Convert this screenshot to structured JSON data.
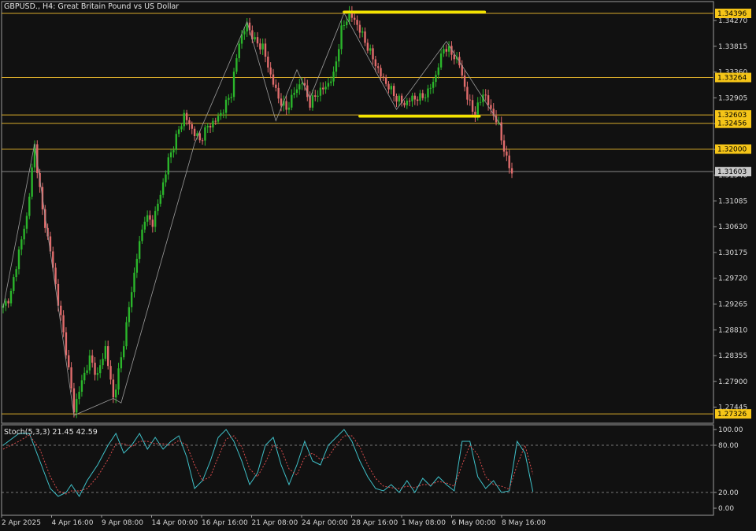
{
  "header": {
    "symbol": "GBPUSD.",
    "timeframe": "H4",
    "description": "Great Britain Pound vs US Dollar"
  },
  "colors": {
    "background": "#111111",
    "bull": "#2bb52b",
    "bear": "#e06c6c",
    "level_line": "#d6a92a",
    "price_line": "#8a8a8a",
    "highlight": "#f2e300",
    "stoch_main": "#3fc1c9",
    "stoch_signal": "#d94c4c"
  },
  "chart_data": [
    {
      "type": "candlestick",
      "title": "GBPUSD., H4:  Great Britain Pound vs US Dollar",
      "ylim": [
        1.27,
        1.346
      ],
      "y_ticks": [
        "1.34270",
        "1.33815",
        "1.33360",
        "1.32905",
        "1.32450",
        "1.31995",
        "1.31540",
        "1.31085",
        "1.30630",
        "1.30175",
        "1.29720",
        "1.29265",
        "1.28810",
        "1.28355",
        "1.27900",
        "1.27445"
      ],
      "x_labels": [
        "2 Apr 2025",
        "4 Apr 16:00",
        "9 Apr 08:00",
        "14 Apr 00:00",
        "16 Apr 16:00",
        "21 Apr 08:00",
        "24 Apr 00:00",
        "28 Apr 16:00",
        "1 May 08:00",
        "6 May 00:00",
        "8 May 16:00"
      ],
      "close_path": [
        [
          0,
          1.292
        ],
        [
          3,
          1.2945
        ],
        [
          6,
          1.302
        ],
        [
          9,
          1.308
        ],
        [
          12,
          1.3205
        ],
        [
          15,
          1.309
        ],
        [
          18,
          1.302
        ],
        [
          21,
          1.293
        ],
        [
          24,
          1.2845
        ],
        [
          27,
          1.274
        ],
        [
          30,
          1.279
        ],
        [
          33,
          1.283
        ],
        [
          36,
          1.28
        ],
        [
          39,
          1.285
        ],
        [
          42,
          1.276
        ],
        [
          45,
          1.283
        ],
        [
          48,
          1.292
        ],
        [
          51,
          1.301
        ],
        [
          54,
          1.308
        ],
        [
          57,
          1.307
        ],
        [
          60,
          1.312
        ],
        [
          63,
          1.318
        ],
        [
          66,
          1.322
        ],
        [
          69,
          1.326
        ],
        [
          72,
          1.3235
        ],
        [
          75,
          1.3215
        ],
        [
          78,
          1.324
        ],
        [
          81,
          1.325
        ],
        [
          84,
          1.327
        ],
        [
          87,
          1.33
        ],
        [
          90,
          1.339
        ],
        [
          93,
          1.342
        ],
        [
          96,
          1.339
        ],
        [
          99,
          1.338
        ],
        [
          102,
          1.333
        ],
        [
          105,
          1.329
        ],
        [
          108,
          1.327
        ],
        [
          111,
          1.33
        ],
        [
          114,
          1.332
        ],
        [
          117,
          1.328
        ],
        [
          120,
          1.33
        ],
        [
          123,
          1.331
        ],
        [
          126,
          1.333
        ],
        [
          129,
          1.341
        ],
        [
          132,
          1.344
        ],
        [
          135,
          1.342
        ],
        [
          138,
          1.339
        ],
        [
          141,
          1.336
        ],
        [
          144,
          1.333
        ],
        [
          147,
          1.331
        ],
        [
          150,
          1.329
        ],
        [
          153,
          1.328
        ],
        [
          156,
          1.329
        ],
        [
          159,
          1.329
        ],
        [
          162,
          1.33
        ],
        [
          165,
          1.333
        ],
        [
          168,
          1.338
        ],
        [
          171,
          1.337
        ],
        [
          174,
          1.335
        ],
        [
          177,
          1.329
        ],
        [
          180,
          1.326
        ],
        [
          183,
          1.33
        ],
        [
          186,
          1.327
        ],
        [
          189,
          1.324
        ],
        [
          192,
          1.318
        ],
        [
          194,
          1.316
        ]
      ],
      "swing_path": [
        [
          0,
          1.292
        ],
        [
          12,
          1.321
        ],
        [
          27,
          1.273
        ],
        [
          42,
          1.276
        ],
        [
          45,
          1.2752
        ],
        [
          73,
          1.321
        ],
        [
          93,
          1.3425
        ],
        [
          99,
          1.333
        ],
        [
          104,
          1.325
        ],
        [
          112,
          1.334
        ],
        [
          117,
          1.329
        ],
        [
          130,
          1.344
        ],
        [
          150,
          1.327
        ],
        [
          169,
          1.339
        ],
        [
          190,
          1.324
        ]
      ],
      "price_labels": [
        {
          "text": "1.34396",
          "value": 1.34396
        },
        {
          "text": "1.33264",
          "value": 1.33264
        },
        {
          "text": "1.32603",
          "value": 1.32603
        },
        {
          "text": "1.32456",
          "value": 1.32456
        },
        {
          "text": "1.32000",
          "value": 1.32
        },
        {
          "text": "1.31603",
          "value": 1.31603
        },
        {
          "text": "1.27326",
          "value": 1.27326
        }
      ],
      "current_price_label": "1.31603",
      "highlights": [
        {
          "from": 133,
          "to": 186,
          "value": 1.3442
        },
        {
          "from": 139,
          "to": 184,
          "value": 1.3258
        }
      ]
    },
    {
      "type": "line",
      "title": "Stoch(5,3,3) 21.45 42.59",
      "ylim": [
        0,
        100
      ],
      "y_ticks": [
        "100.00",
        "80.00",
        "20.00",
        "0.00"
      ],
      "levels": [
        80,
        20
      ],
      "series": [
        {
          "name": "main",
          "color": "#3fc1c9",
          "points": [
            [
              0,
              80
            ],
            [
              6,
              95
            ],
            [
              10,
              95
            ],
            [
              14,
              60
            ],
            [
              18,
              25
            ],
            [
              21,
              15
            ],
            [
              24,
              20
            ],
            [
              26,
              30
            ],
            [
              29,
              15
            ],
            [
              32,
              35
            ],
            [
              36,
              55
            ],
            [
              40,
              80
            ],
            [
              43,
              95
            ],
            [
              46,
              70
            ],
            [
              49,
              80
            ],
            [
              52,
              95
            ],
            [
              55,
              75
            ],
            [
              58,
              90
            ],
            [
              61,
              75
            ],
            [
              64,
              85
            ],
            [
              67,
              92
            ],
            [
              70,
              65
            ],
            [
              73,
              25
            ],
            [
              76,
              35
            ],
            [
              79,
              60
            ],
            [
              82,
              90
            ],
            [
              85,
              100
            ],
            [
              88,
              85
            ],
            [
              91,
              60
            ],
            [
              94,
              30
            ],
            [
              97,
              45
            ],
            [
              100,
              80
            ],
            [
              103,
              90
            ],
            [
              106,
              55
            ],
            [
              109,
              30
            ],
            [
              112,
              55
            ],
            [
              115,
              85
            ],
            [
              118,
              60
            ],
            [
              121,
              55
            ],
            [
              124,
              80
            ],
            [
              127,
              90
            ],
            [
              130,
              100
            ],
            [
              133,
              85
            ],
            [
              136,
              60
            ],
            [
              139,
              40
            ],
            [
              142,
              25
            ],
            [
              145,
              22
            ],
            [
              148,
              30
            ],
            [
              151,
              20
            ],
            [
              154,
              35
            ],
            [
              157,
              20
            ],
            [
              160,
              38
            ],
            [
              163,
              28
            ],
            [
              166,
              40
            ],
            [
              169,
              30
            ],
            [
              172,
              22
            ],
            [
              175,
              85
            ],
            [
              178,
              85
            ],
            [
              181,
              40
            ],
            [
              184,
              25
            ],
            [
              187,
              35
            ],
            [
              190,
              20
            ],
            [
              193,
              22
            ],
            [
              196,
              85
            ],
            [
              199,
              70
            ],
            [
              202,
              21
            ]
          ]
        },
        {
          "name": "signal",
          "color": "#d94c4c",
          "points": [
            [
              0,
              75
            ],
            [
              6,
              85
            ],
            [
              10,
              93
            ],
            [
              14,
              75
            ],
            [
              18,
              40
            ],
            [
              21,
              22
            ],
            [
              24,
              18
            ],
            [
              26,
              22
            ],
            [
              29,
              22
            ],
            [
              32,
              25
            ],
            [
              36,
              40
            ],
            [
              40,
              62
            ],
            [
              43,
              82
            ],
            [
              46,
              82
            ],
            [
              49,
              78
            ],
            [
              52,
              85
            ],
            [
              55,
              85
            ],
            [
              58,
              82
            ],
            [
              61,
              82
            ],
            [
              64,
              80
            ],
            [
              67,
              86
            ],
            [
              70,
              80
            ],
            [
              73,
              55
            ],
            [
              76,
              35
            ],
            [
              79,
              40
            ],
            [
              82,
              65
            ],
            [
              85,
              88
            ],
            [
              88,
              92
            ],
            [
              91,
              78
            ],
            [
              94,
              50
            ],
            [
              97,
              40
            ],
            [
              100,
              58
            ],
            [
              103,
              80
            ],
            [
              106,
              75
            ],
            [
              109,
              50
            ],
            [
              112,
              42
            ],
            [
              115,
              65
            ],
            [
              118,
              70
            ],
            [
              121,
              62
            ],
            [
              124,
              65
            ],
            [
              127,
              80
            ],
            [
              130,
              92
            ],
            [
              133,
              92
            ],
            [
              136,
              78
            ],
            [
              139,
              55
            ],
            [
              142,
              38
            ],
            [
              145,
              28
            ],
            [
              148,
              26
            ],
            [
              151,
              25
            ],
            [
              154,
              28
            ],
            [
              157,
              26
            ],
            [
              160,
              30
            ],
            [
              163,
              30
            ],
            [
              166,
              34
            ],
            [
              169,
              32
            ],
            [
              172,
              28
            ],
            [
              175,
              55
            ],
            [
              178,
              80
            ],
            [
              181,
              68
            ],
            [
              184,
              40
            ],
            [
              187,
              30
            ],
            [
              190,
              28
            ],
            [
              193,
              24
            ],
            [
              196,
              55
            ],
            [
              199,
              80
            ],
            [
              202,
              43
            ]
          ]
        }
      ]
    }
  ]
}
